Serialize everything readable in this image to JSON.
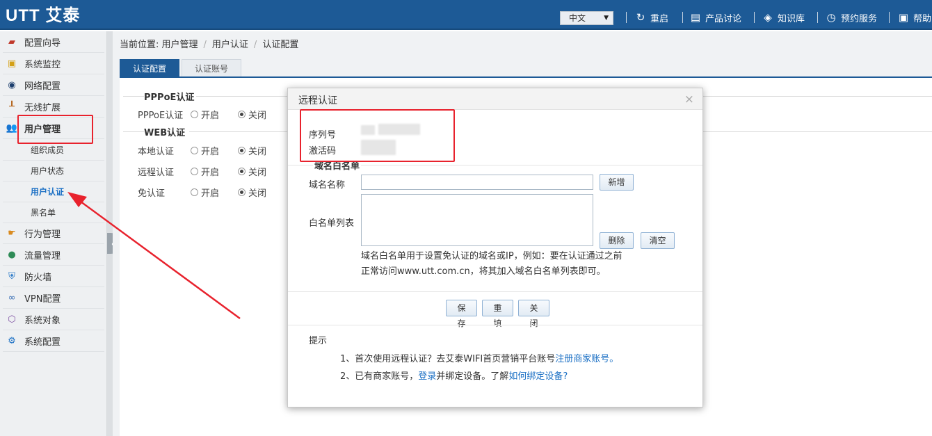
{
  "header": {
    "logo": "UTT 艾泰",
    "lang": "中文",
    "nav": [
      {
        "label": "重启",
        "icon": "restart-icon"
      },
      {
        "label": "产品讨论",
        "icon": "chat-icon"
      },
      {
        "label": "知识库",
        "icon": "book-stack-icon"
      },
      {
        "label": "预约服务",
        "icon": "clock-icon"
      },
      {
        "label": "帮助",
        "icon": "help-book-icon"
      }
    ]
  },
  "sidebar": {
    "items": [
      {
        "label": "配置向导",
        "icon": "wizard-icon"
      },
      {
        "label": "系统监控",
        "icon": "monitor-icon"
      },
      {
        "label": "网络配置",
        "icon": "network-icon"
      },
      {
        "label": "无线扩展",
        "icon": "wireless-icon"
      },
      {
        "label": "用户管理",
        "icon": "users-icon"
      },
      {
        "label": "行为管理",
        "icon": "hand-icon"
      },
      {
        "label": "流量管理",
        "icon": "traffic-icon"
      },
      {
        "label": "防火墙",
        "icon": "shield-icon"
      },
      {
        "label": "VPN配置",
        "icon": "vpn-icon"
      },
      {
        "label": "系统对象",
        "icon": "cube-icon"
      },
      {
        "label": "系统配置",
        "icon": "gear-icon"
      }
    ],
    "subitems": [
      "组织成员",
      "用户状态",
      "用户认证",
      "黑名单"
    ]
  },
  "main": {
    "breadcrumb": {
      "prefix": "当前位置: 用户管理",
      "mid": "用户认证",
      "last": "认证配置"
    },
    "tabs": [
      "认证配置",
      "认证账号"
    ],
    "pppoe_title": "PPPoE认证",
    "web_title": "WEB认证",
    "rows": [
      {
        "label": "PPPoE认证"
      },
      {
        "label": "本地认证"
      },
      {
        "label": "远程认证"
      },
      {
        "label": "免认证"
      }
    ],
    "on_label": "开启",
    "off_label": "关闭"
  },
  "modal": {
    "title": "远程认证",
    "serial_label": "序列号",
    "activation_label": "激活码",
    "whitelist_title": "域名白名单",
    "domain_label": "域名名称",
    "domain_value": "",
    "add_btn": "新增",
    "list_label": "白名单列表",
    "delete_btn": "删除",
    "clear_btn": "清空",
    "note_line1": "域名白名单用于设置免认证的域名或IP，例如：要在认证通过之前",
    "note_line2": "正常访问www.utt.com.cn，将其加入域名白名单列表即可。",
    "save_btn": "保存",
    "reset_btn": "重填",
    "close_btn": "关闭",
    "tips_title": "提示",
    "tip1_text": "1、首次使用远程认证？去艾泰WIFI首页营销平台账号",
    "tip1_link": "注册商家账号。",
    "tip2_a": "2、已有商家账号，",
    "tip2_link1": "登录",
    "tip2_b": "并绑定设备。了解",
    "tip2_link2": "如何绑定设备?"
  },
  "colors": {
    "header": "#1d5a96",
    "accent_link": "#1a6fc4",
    "annotation": "#e8222d"
  }
}
